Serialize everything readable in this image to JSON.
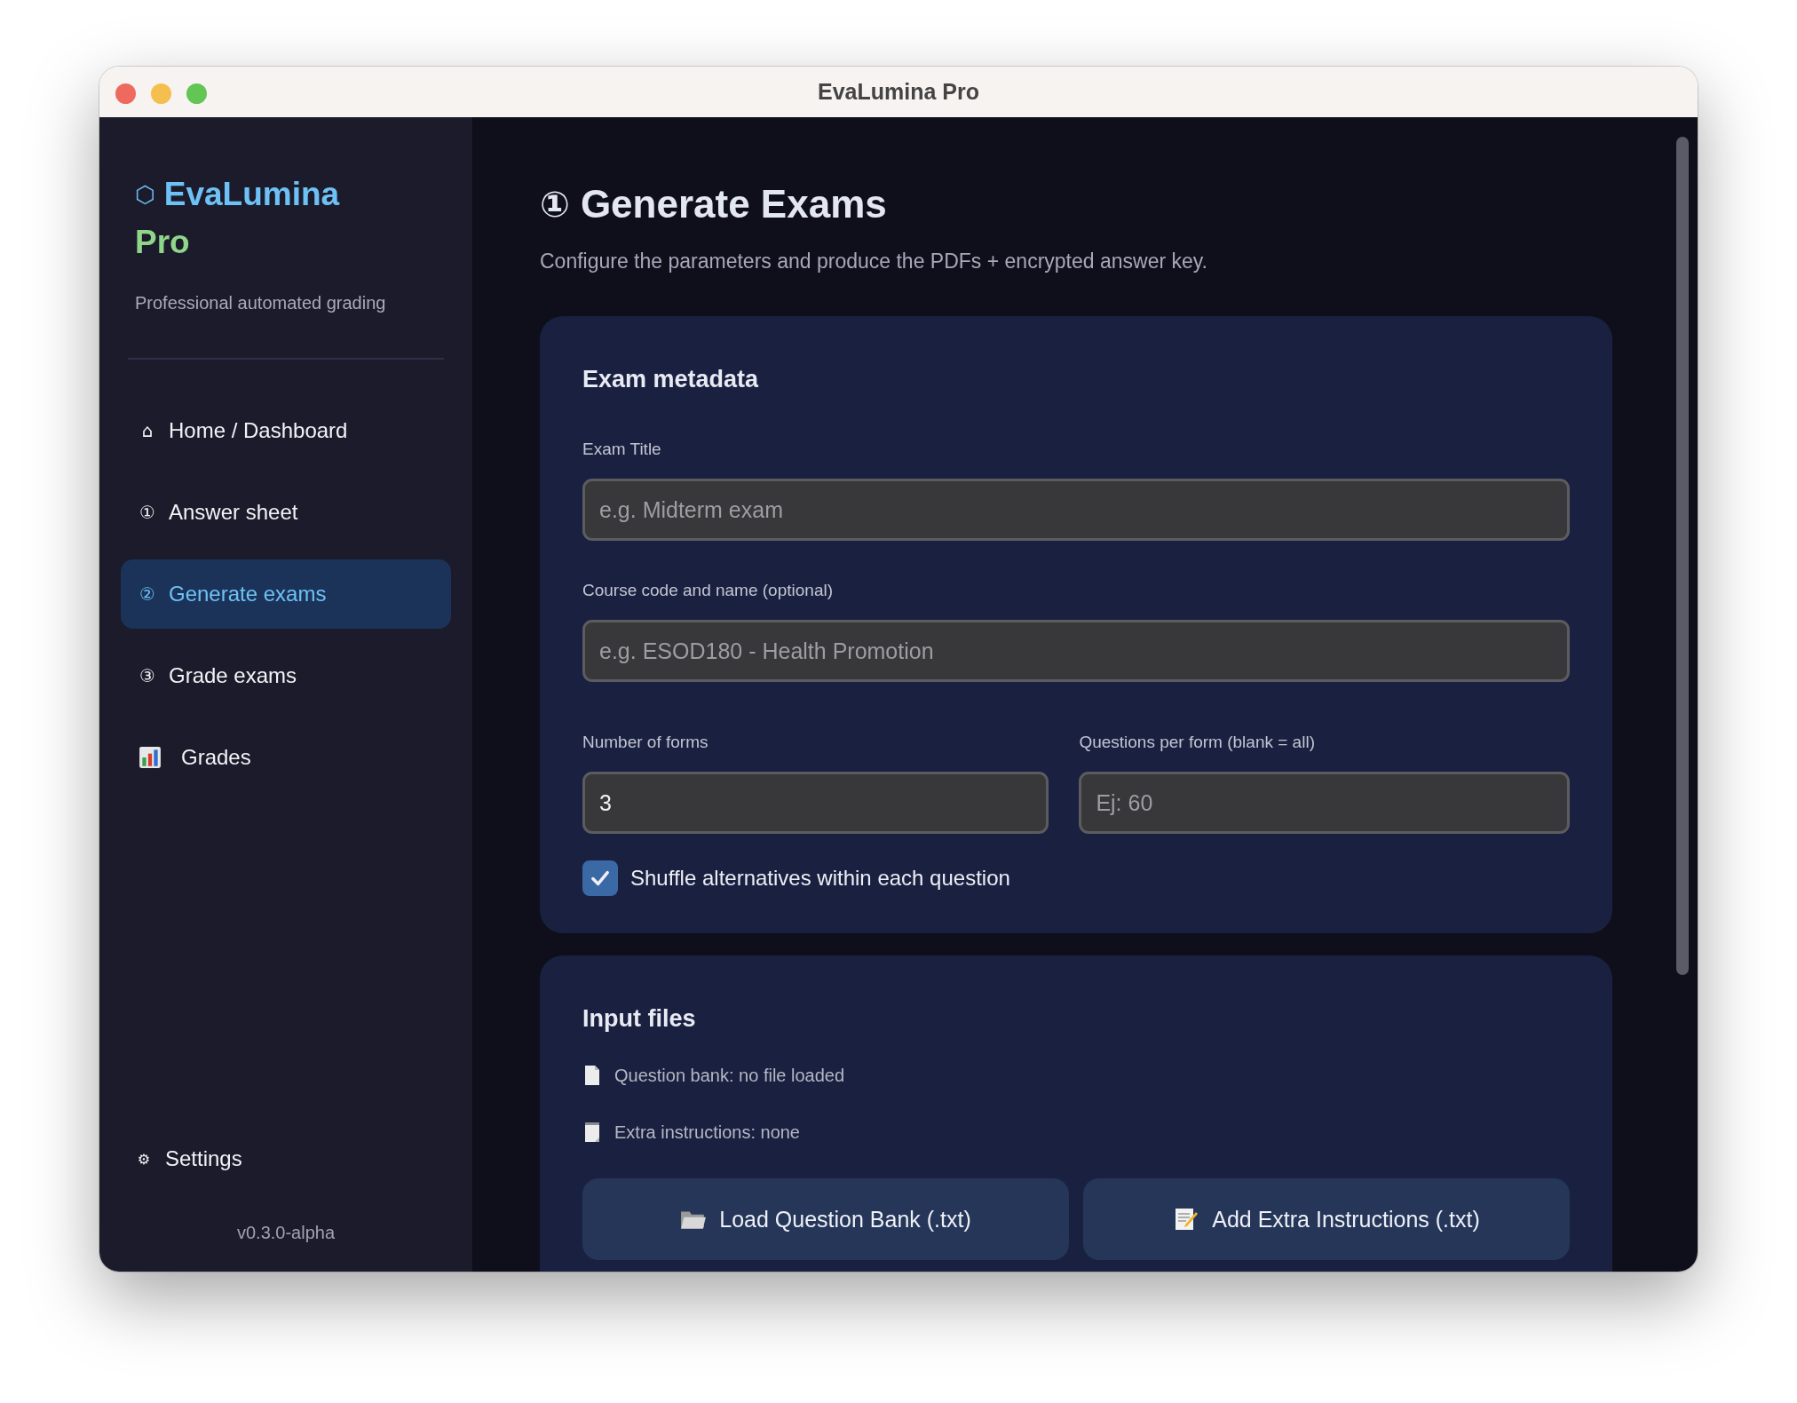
{
  "window": {
    "title": "EvaLumina Pro"
  },
  "sidebar": {
    "brand": {
      "icon": "⬡",
      "name": "EvaLumina",
      "suffix": "Pro"
    },
    "tagline": "Professional automated grading",
    "items": [
      {
        "glyph": "⌂",
        "label": "Home / Dashboard",
        "selected": false
      },
      {
        "glyph": "①",
        "label": "Answer sheet",
        "selected": false
      },
      {
        "glyph": "②",
        "label": "Generate exams",
        "selected": true
      },
      {
        "glyph": "③",
        "label": "Grade exams",
        "selected": false
      },
      {
        "kind": "chart",
        "label": "Grades",
        "selected": false
      }
    ],
    "footer_item": {
      "glyph": "⚙",
      "label": "Settings"
    },
    "version": "v0.3.0-alpha"
  },
  "page": {
    "icon": "①",
    "title": "Generate Exams",
    "subtitle": "Configure the parameters and produce the PDFs + encrypted answer key."
  },
  "metadata_card": {
    "title": "Exam metadata",
    "exam_title": {
      "label": "Exam Title",
      "placeholder": "e.g. Midterm exam"
    },
    "course": {
      "label": "Course code and name (optional)",
      "placeholder": "e.g. ESOD180 - Health Promotion"
    },
    "forms": {
      "label": "Number of forms",
      "value": "3"
    },
    "questions": {
      "label": "Questions per form (blank = all)",
      "placeholder": "Ej: 60"
    },
    "shuffle": {
      "label": "Shuffle alternatives within each question",
      "checked": true
    }
  },
  "files_card": {
    "title": "Input files",
    "status": [
      {
        "kind": "bank",
        "text": "Question bank: no file loaded"
      },
      {
        "kind": "instructions",
        "text": "Extra instructions: none"
      }
    ],
    "buttons": [
      {
        "kind": "bank",
        "label": "Load Question Bank (.txt)"
      },
      {
        "kind": "instructions",
        "label": "Add Extra Instructions (.txt)"
      }
    ]
  }
}
